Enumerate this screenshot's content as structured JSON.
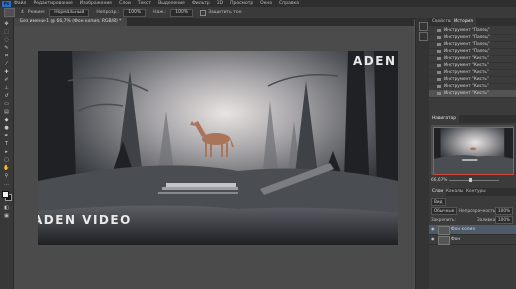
{
  "menu": {
    "logo": "Ps",
    "items": [
      "Файл",
      "Редактирование",
      "Изображение",
      "Слои",
      "Текст",
      "Выделение",
      "Фильтр",
      "3D",
      "Просмотр",
      "Окно",
      "Справка"
    ]
  },
  "options": {
    "brush_size": "4",
    "mode_label": "Режим:",
    "mode_value": "Нормальный",
    "opacity_label": "Непрозр.:",
    "opacity_value": "100%",
    "flow_label": "Наж.:",
    "flow_value": "100%",
    "protect_label": "Защитить тон"
  },
  "document": {
    "tab_label": "Без имени-1 @ 66,7% (Фон копия, RGB/8) *"
  },
  "watermark": {
    "top": "ADEN VIDEO",
    "bottom": "ADEN VIDEO"
  },
  "panels": {
    "tabs_top": [
      "Свойства",
      "История"
    ],
    "history": [
      "Инструмент \"Палец\"",
      "Инструмент \"Палец\"",
      "Инструмент \"Палец\"",
      "Инструмент \"Палец\"",
      "Инструмент \"Кисть\"",
      "Инструмент \"Кисть\"",
      "Инструмент \"Кисть\"",
      "Инструмент \"Кисть\"",
      "Инструмент \"Кисть\"",
      "Инструмент \"Кисть\""
    ],
    "navigator_tab": "Навигатор",
    "zoom": "66,67%",
    "tabs_layers": [
      "Слои",
      "Каналы",
      "Контуры"
    ],
    "kind_label": "Вид",
    "blend_mode": "Обычные",
    "opacity_label": "Непрозрачность:",
    "opacity_value": "100%",
    "lock_label": "Закрепить:",
    "fill_label": "Заливка:",
    "fill_value": "100%",
    "layers": [
      {
        "name": "Фон копия",
        "selected": true
      },
      {
        "name": "Фон",
        "selected": false
      }
    ]
  },
  "colors": {
    "accent": "#d24a3a",
    "canvas_bg": "#2f3337"
  }
}
